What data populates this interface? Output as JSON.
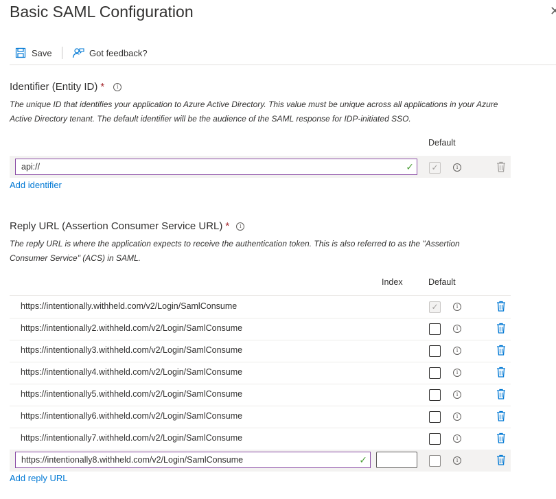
{
  "header": {
    "title": "Basic SAML Configuration",
    "close_label": "✕"
  },
  "toolbar": {
    "save_label": "Save",
    "feedback_label": "Got feedback?"
  },
  "identifier": {
    "title": "Identifier (Entity ID)",
    "required_mark": "*",
    "description": "The unique ID that identifies your application to Azure Active Directory. This value must be unique across all applications in your Azure Active Directory tenant. The default identifier will be the audience of the SAML response for IDP-initiated SSO.",
    "default_header": "Default",
    "value": "api://",
    "add_label": "Add identifier"
  },
  "reply": {
    "title": "Reply URL (Assertion Consumer Service URL)",
    "required_mark": "*",
    "description": "The reply URL is where the application expects to receive the authentication token. This is also referred to as the \"Assertion Consumer Service\" (ACS) in SAML.",
    "index_header": "Index",
    "default_header": "Default",
    "urls": [
      "https://intentionally.withheld.com/v2/Login/SamlConsume",
      "https://intentionally2.withheld.com/v2/Login/SamlConsume",
      "https://intentionally3.withheld.com/v2/Login/SamlConsume",
      "https://intentionally4.withheld.com/v2/Login/SamlConsume",
      "https://intentionally5.withheld.com/v2/Login/SamlConsume",
      "https://intentionally6.withheld.com/v2/Login/SamlConsume",
      "https://intentionally7.withheld.com/v2/Login/SamlConsume"
    ],
    "editing_value": "https://intentionally8.withheld.com/v2/Login/SamlConsume",
    "add_label": "Add reply URL"
  },
  "colors": {
    "link": "#0078d4",
    "required": "#a4262c",
    "valid": "#4c9f38",
    "delete": "#0078d4"
  }
}
